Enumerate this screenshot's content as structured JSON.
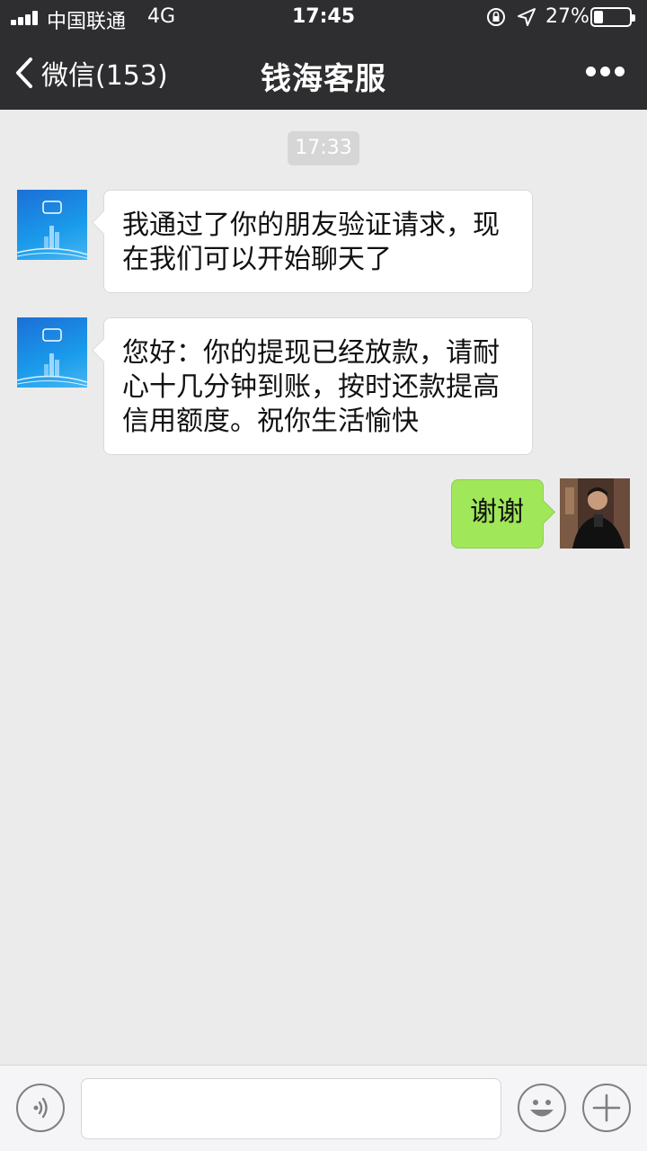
{
  "status_bar": {
    "carrier": "中国联通",
    "network": "4G",
    "time": "17:45",
    "battery_percent": "27%",
    "battery_level": 0.27
  },
  "nav": {
    "back_label": "微信(153)",
    "title": "钱海客服"
  },
  "chat": {
    "timestamp": "17:33",
    "messages": [
      {
        "side": "left",
        "line1": "我通过了你的朋友验证请求，现",
        "line2": "在我们可以开始聊天了"
      },
      {
        "side": "left",
        "line1": "您好：你的提现已经放款，请耐",
        "line2": "心十几分钟到账，按时还款提高",
        "line3": "信用额度。祝你生活愉快"
      },
      {
        "side": "right",
        "text": "谢谢"
      }
    ]
  },
  "input": {
    "placeholder": ""
  },
  "colors": {
    "header_bg": "#2e2e30",
    "chat_bg": "#ebebeb",
    "sent_bubble": "#a0e75a",
    "received_bubble": "#ffffff"
  },
  "icons": [
    "back-chevron-icon",
    "more-dots-icon",
    "voice-icon",
    "emoji-icon",
    "plus-icon",
    "location-arrow-icon",
    "rotation-lock-icon",
    "battery-icon",
    "signal-icon"
  ]
}
